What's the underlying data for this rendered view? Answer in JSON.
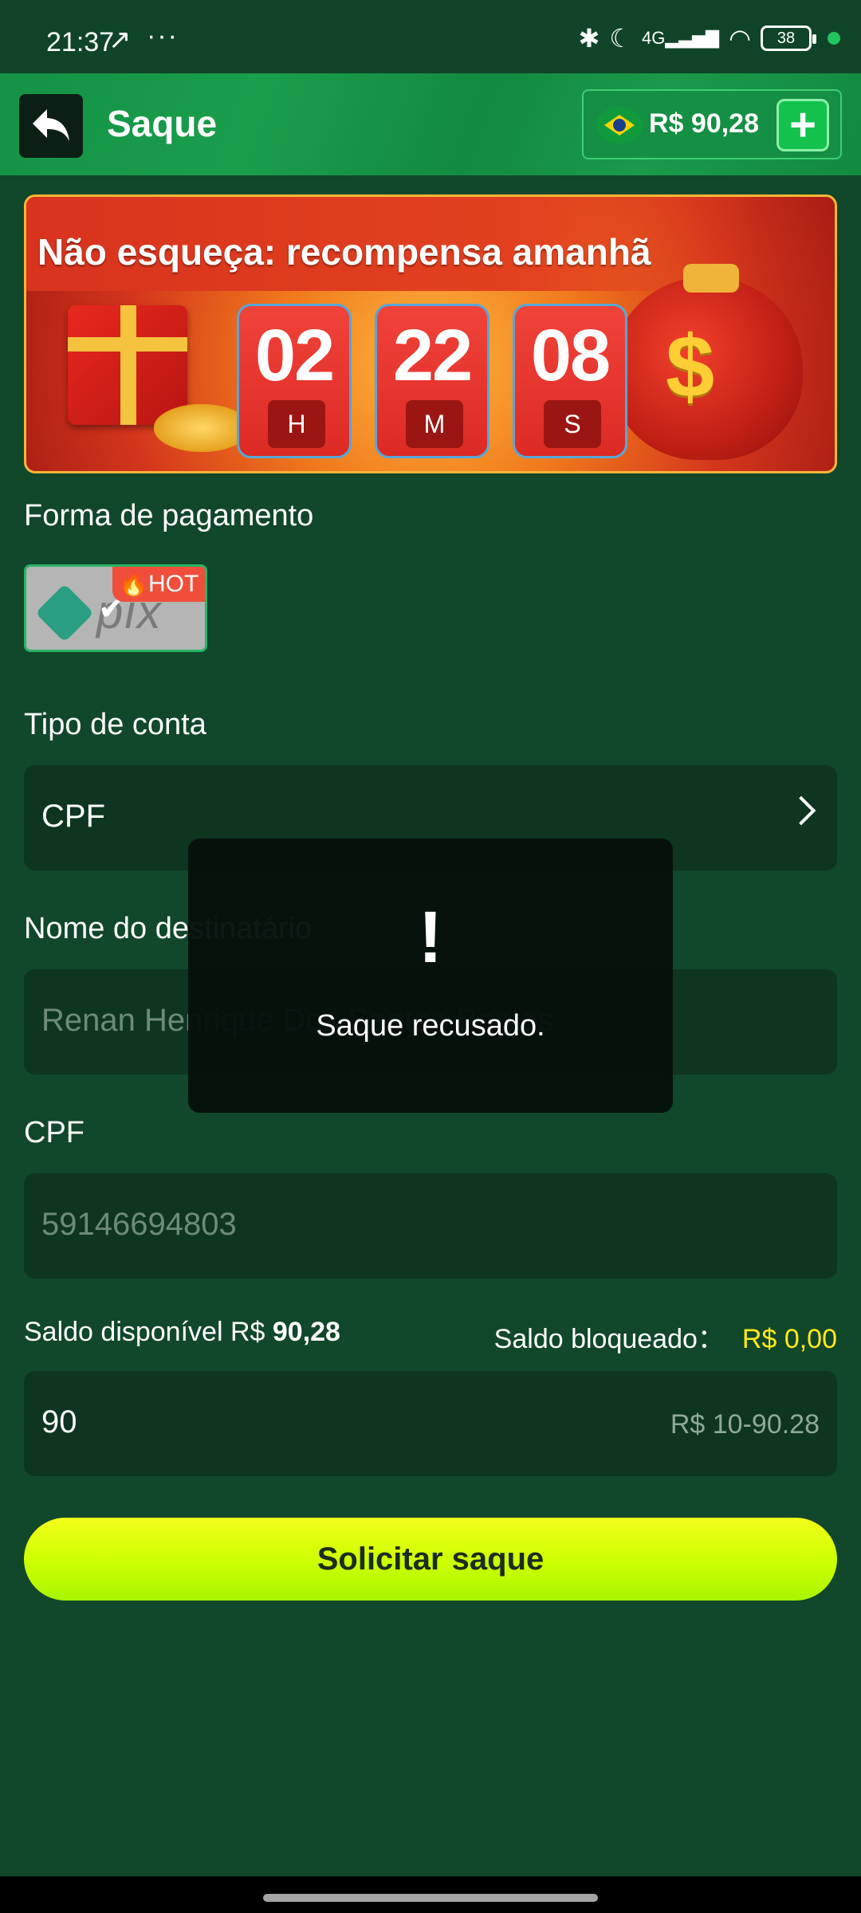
{
  "status_bar": {
    "time": "21:37",
    "network": "4G",
    "battery": "38"
  },
  "header": {
    "title": "Saque",
    "balance": "R$ 90,28"
  },
  "banner": {
    "title": "Não esqueça: recompensa amanhã",
    "timer": [
      {
        "value": "02",
        "unit": "H"
      },
      {
        "value": "22",
        "unit": "M"
      },
      {
        "value": "08",
        "unit": "S"
      }
    ]
  },
  "payment": {
    "label": "Forma de pagamento",
    "method": "pix",
    "badge": "HOT"
  },
  "account_type": {
    "label": "Tipo de conta",
    "value": "CPF"
  },
  "recipient": {
    "label": "Nome do destinatário",
    "value": "Renan Henrique Dos Santos Bastos"
  },
  "cpf": {
    "label": "CPF",
    "value": "59146694803"
  },
  "saldo": {
    "available_label": "Saldo disponível R$",
    "available_value": "90,28",
    "blocked_label": "Saldo bloqueado：",
    "blocked_value": "R$ 0,00"
  },
  "amount": {
    "value": "90",
    "range_hint": "R$ 10-90.28"
  },
  "submit": {
    "label": "Solicitar saque"
  },
  "toast": {
    "icon": "!",
    "message": "Saque recusado."
  },
  "colors": {
    "background": "#11472a",
    "header": "#149245",
    "button": "#ccff00",
    "blocked_value": "#ffea1a"
  }
}
